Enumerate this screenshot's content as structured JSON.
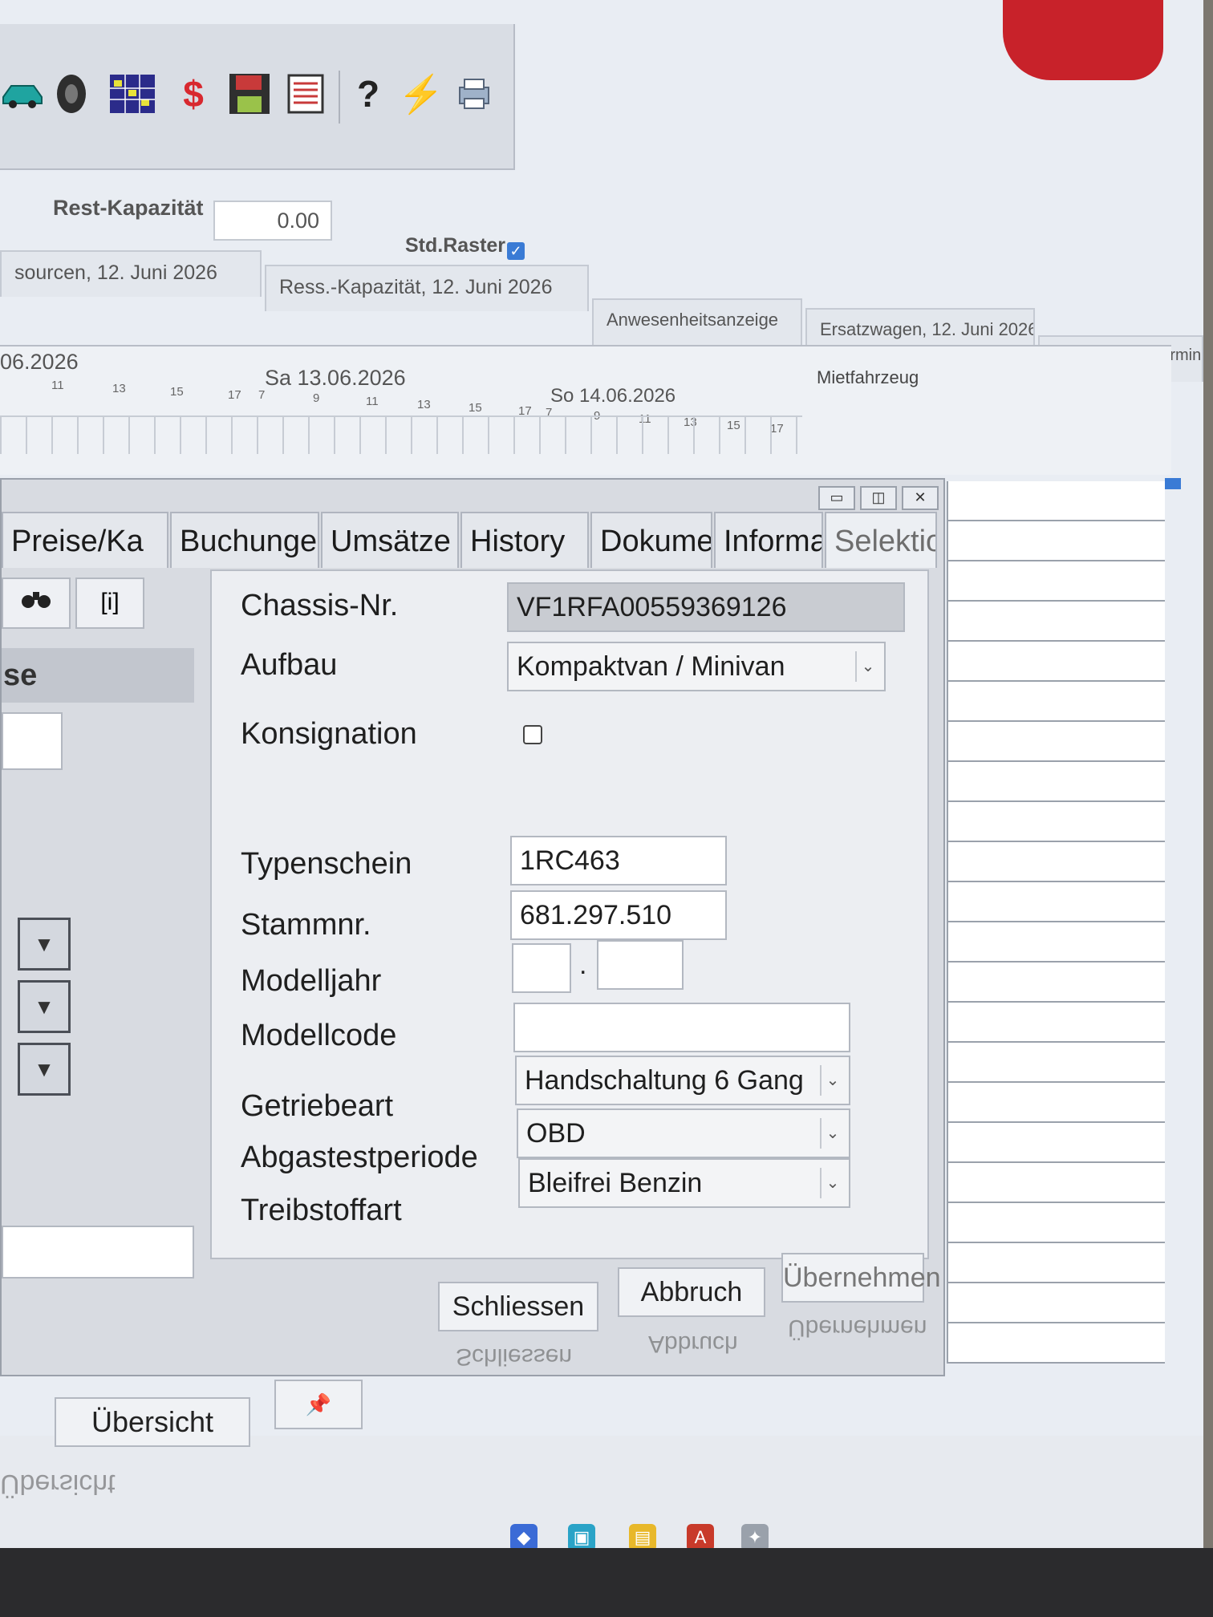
{
  "toolbar": {
    "icons": [
      "car-icon",
      "tire-icon",
      "grid-icon",
      "dollar-icon",
      "save-icon",
      "list-icon",
      "help-icon",
      "lightning-icon",
      "print-icon"
    ],
    "symbols": {
      "dollar": "$",
      "help": "?",
      "lightning": "⚡"
    }
  },
  "capacity": {
    "label": "Rest-Kapazität",
    "value": "0.00",
    "raster_label": "Std.Raster",
    "raster_checked": true
  },
  "top_tabs": [
    "sourcen, 12. Juni 2026",
    "Ress.-Kapazität, 12. Juni 2026",
    "Anwesenheitsanzeige",
    "Ersatzwagen, 12. Juni 2026",
    "Provisorische Termine"
  ],
  "timeline": {
    "dates": [
      "06.2026",
      "Sa 13.06.2026",
      "So 14.06.2026"
    ],
    "hours_a": [
      "11",
      "13",
      "15",
      "17"
    ],
    "hours_b": [
      "7",
      "9",
      "11",
      "13",
      "15",
      "17"
    ],
    "hours_c": [
      "7",
      "9",
      "11",
      "13",
      "15",
      "17"
    ],
    "vehicle_type": "Mietfahrzeug"
  },
  "dialog": {
    "window_buttons": [
      "▭",
      "◫",
      "✕"
    ],
    "tabs": [
      "Preise/Ka",
      "Buchunge",
      "Umsätze",
      "History",
      "Dokumen",
      "Informatio",
      "Selektion"
    ],
    "side": {
      "banner": "se",
      "info_button": "[i]"
    },
    "fields": {
      "chassis": {
        "label": "Chassis-Nr.",
        "value": "VF1RFA00559369126"
      },
      "aufbau": {
        "label": "Aufbau",
        "value": "Kompaktvan / Minivan"
      },
      "konsignation": {
        "label": "Konsignation",
        "checked": false
      },
      "typenschein": {
        "label": "Typenschein",
        "value": "1RC463"
      },
      "stammnr": {
        "label": "Stammnr.",
        "value": "681.297.510"
      },
      "modelljahr": {
        "label": "Modelljahr",
        "value_a": "",
        "value_b": "",
        "separator": "."
      },
      "modellcode": {
        "label": "Modellcode",
        "value": ""
      },
      "getriebeart": {
        "label": "Getriebeart",
        "value": "Handschaltung 6 Gang"
      },
      "abgastest": {
        "label": "Abgastestperiode",
        "value": "OBD"
      },
      "treibstoff": {
        "label": "Treibstoffart",
        "value": "Bleifrei Benzin"
      }
    },
    "buttons": {
      "uebersicht": "Übersicht",
      "pin": "📌",
      "schliessen": "Schliessen",
      "abbruch": "Abbruch",
      "uebernehmen": "Übernehmen"
    }
  },
  "colors": {
    "accent": "#3a7bd5",
    "window_bg": "#d8dbe1",
    "panel_bg": "#eceef2"
  }
}
